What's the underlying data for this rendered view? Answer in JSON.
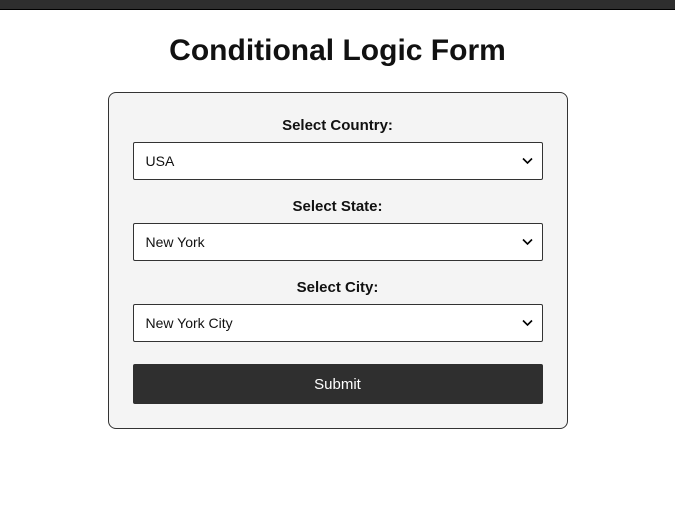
{
  "title": "Conditional Logic Form",
  "fields": {
    "country": {
      "label": "Select Country:",
      "value": "USA"
    },
    "state": {
      "label": "Select State:",
      "value": "New York"
    },
    "city": {
      "label": "Select City:",
      "value": "New York City"
    }
  },
  "submit_label": "Submit"
}
